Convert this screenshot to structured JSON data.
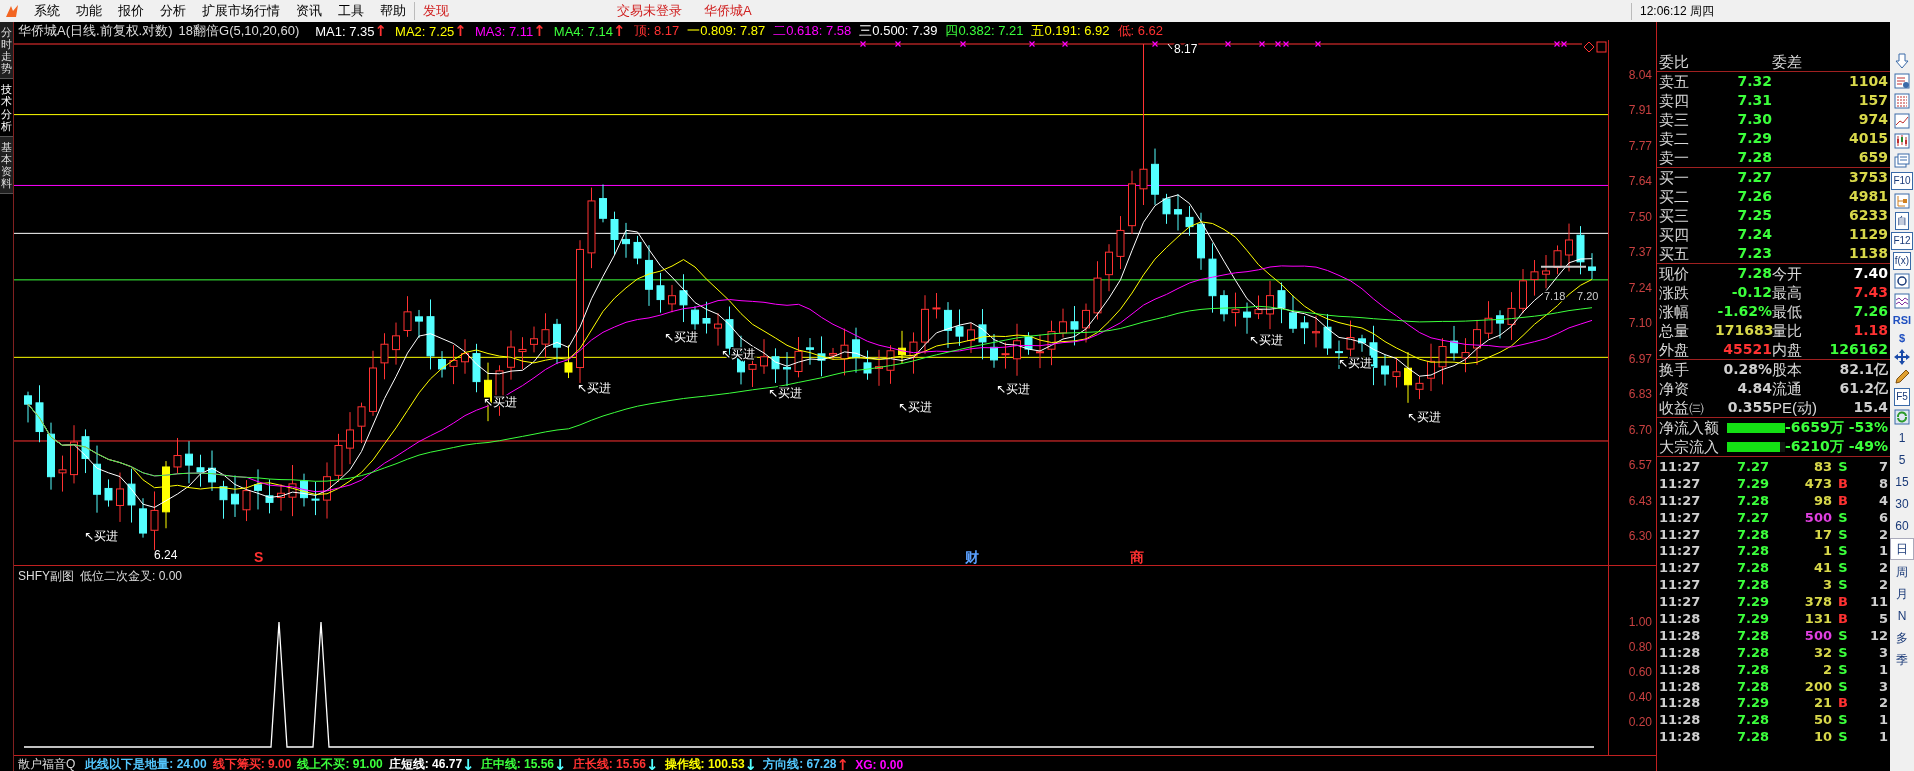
{
  "menu": {
    "items": [
      {
        "label": "系统",
        "highlighted": false
      },
      {
        "label": "功能",
        "highlighted": false
      },
      {
        "label": "报价",
        "highlighted": false
      },
      {
        "label": "分析",
        "highlighted": false
      },
      {
        "label": "扩展市场行情",
        "highlighted": false
      },
      {
        "label": "资讯",
        "highlighted": false
      },
      {
        "label": "工具",
        "highlighted": false
      },
      {
        "label": "帮助",
        "highlighted": false
      },
      {
        "label": "发现",
        "highlighted": true
      }
    ],
    "trade_status": "交易未登录",
    "stock_name": "华侨城A",
    "clock": "12:06:12 周四"
  },
  "side_tabs": [
    {
      "label": "分时走势",
      "selected": false
    },
    {
      "label": "技术分析",
      "selected": true
    },
    {
      "label": "基本资料",
      "selected": false
    }
  ],
  "chart_header": {
    "title": "华侨城A(日线.前复权.对数)",
    "indicator": "18翻倍G(5,10,20,60)",
    "values": [
      {
        "text": "MA1: 7.35",
        "color": "#ffffff",
        "arrow": {
          "text": "↑",
          "color": "#ff3232"
        }
      },
      {
        "text": "MA2: 7.25",
        "color": "#ffff00",
        "arrow": {
          "text": "↑",
          "color": "#ff3232"
        }
      },
      {
        "text": "MA3: 7.11",
        "color": "#ff00ff",
        "arrow": {
          "text": "↑",
          "color": "#ff3232"
        }
      },
      {
        "text": "MA4: 7.14",
        "color": "#3cff3c",
        "arrow": {
          "text": "↑",
          "color": "#ff3232"
        }
      },
      {
        "text": "顶: 8.17",
        "color": "#ff3232"
      },
      {
        "text": "一0.809: 7.87",
        "color": "#ffff00"
      },
      {
        "text": "二0.618: 7.58",
        "color": "#ff00ff"
      },
      {
        "text": "三0.500: 7.39",
        "color": "#ffffff"
      },
      {
        "text": "四0.382: 7.21",
        "color": "#3cff3c"
      },
      {
        "text": "五0.191: 6.92",
        "color": "#ffff00"
      },
      {
        "text": "低: 6.62",
        "color": "#ff3232"
      }
    ]
  },
  "price_axis": [
    "8.04",
    "7.91",
    "7.77",
    "7.64",
    "7.50",
    "7.37",
    "7.24",
    "7.10",
    "6.97",
    "6.83",
    "6.70",
    "6.57",
    "6.43",
    "6.30"
  ],
  "buy_signals": [
    "↖买进",
    "↖买进",
    "↖买进",
    "↖买进",
    "↖买进",
    "↖买进",
    "↖买进",
    "↖买进",
    "↖买进",
    "↖买进",
    "↖买进"
  ],
  "peak_label": "8.17",
  "low_label": "6.24",
  "range_labels": [
    "7.18",
    "7.20"
  ],
  "event_marks": [
    {
      "text": "S",
      "color": "#ff3232"
    },
    {
      "text": "财",
      "color": "#5aa0ff"
    },
    {
      "text": "商",
      "color": "#ff3232"
    }
  ],
  "sub_chart": {
    "title": "SHFY副图",
    "reading": "低位二次金叉: 0.00",
    "axis": [
      "1.00",
      "0.80",
      "0.60",
      "0.40",
      "0.20"
    ]
  },
  "bottom_bar": {
    "name": "散户福音Q",
    "values": [
      {
        "text": "此线以下是地量: 24.00",
        "color": "#54c8ff"
      },
      {
        "text": "线下筹买: 9.00",
        "color": "#ff3232"
      },
      {
        "text": "线上不买: 91.00",
        "color": "#3cff3c"
      },
      {
        "text": "庄短线: 46.77",
        "color": "#ffffff",
        "arrow": {
          "text": "↓",
          "color": "#54ffff"
        }
      },
      {
        "text": "庄中线: 15.56",
        "color": "#3cff3c",
        "arrow": {
          "text": "↓",
          "color": "#54ffff"
        }
      },
      {
        "text": "庄长线: 15.56",
        "color": "#ff3232",
        "arrow": {
          "text": "↓",
          "color": "#54ffff"
        }
      },
      {
        "text": "操作线: 100.53",
        "color": "#ffff00",
        "arrow": {
          "text": "↓",
          "color": "#54ffff"
        }
      },
      {
        "text": "方向线: 67.28",
        "color": "#54c8ff",
        "arrow": {
          "text": "↑",
          "color": "#ff3232"
        }
      },
      {
        "text": "XG: 0.00",
        "color": "#ff00ff"
      }
    ]
  },
  "quote": {
    "ratio": {
      "label": "委比",
      "label2": "委差"
    },
    "asks": [
      {
        "label": "卖五",
        "price": "7.32",
        "volume": "1104"
      },
      {
        "label": "卖四",
        "price": "7.31",
        "volume": "157"
      },
      {
        "label": "卖三",
        "price": "7.30",
        "volume": "974"
      },
      {
        "label": "卖二",
        "price": "7.29",
        "volume": "4015"
      },
      {
        "label": "卖一",
        "price": "7.28",
        "volume": "659"
      }
    ],
    "bids": [
      {
        "label": "买一",
        "price": "7.27",
        "volume": "3753"
      },
      {
        "label": "买二",
        "price": "7.26",
        "volume": "4981"
      },
      {
        "label": "买三",
        "price": "7.25",
        "volume": "6233"
      },
      {
        "label": "买四",
        "price": "7.24",
        "volume": "1129"
      },
      {
        "label": "买五",
        "price": "7.23",
        "volume": "1138"
      }
    ],
    "stats": [
      {
        "cells": [
          {
            "label": "现价",
            "value": "7.28",
            "color": "#3cff3c"
          },
          {
            "label": "今开",
            "value": "7.40",
            "color": "#ffffff"
          }
        ]
      },
      {
        "cells": [
          {
            "label": "涨跌",
            "value": "-0.12",
            "color": "#3cff3c"
          },
          {
            "label": "最高",
            "value": "7.43",
            "color": "#ff3232"
          }
        ]
      },
      {
        "cells": [
          {
            "label": "涨幅",
            "value": "-1.62%",
            "color": "#3cff3c"
          },
          {
            "label": "最低",
            "value": "7.26",
            "color": "#3cff3c"
          }
        ]
      },
      {
        "cells": [
          {
            "label": "总量",
            "value": "171683",
            "color": "#d8d84a"
          },
          {
            "label": "量比",
            "value": "1.18",
            "color": "#ff3232"
          }
        ]
      },
      {
        "cells": [
          {
            "label": "外盘",
            "value": "45521",
            "color": "#ff3232"
          },
          {
            "label": "内盘",
            "value": "126162",
            "color": "#3cff3c"
          }
        ]
      }
    ],
    "fundamentals": [
      {
        "label": "换手",
        "value": "0.28%",
        "label2": "股本",
        "value2": "82.1亿"
      },
      {
        "label": "净资",
        "value": "4.84",
        "label2": "流通",
        "value2": "61.2亿"
      },
      {
        "label": "收益㈢",
        "value": "0.355",
        "label2": "PE(动)",
        "value2": "15.4"
      }
    ],
    "flows": [
      {
        "label": "净流入额",
        "level": 1,
        "amount": "-6659万",
        "pct": "-53%"
      },
      {
        "label": "大宗流入",
        "level": 0.92,
        "amount": "-6210万",
        "pct": "-49%"
      }
    ],
    "ticks": [
      {
        "time": "11:27",
        "price": "7.27",
        "volume": "83",
        "side": "S",
        "kind": "sell",
        "big": false,
        "count": "7"
      },
      {
        "time": "11:27",
        "price": "7.29",
        "volume": "473",
        "side": "B",
        "kind": "buy",
        "big": false,
        "count": "8"
      },
      {
        "time": "11:27",
        "price": "7.28",
        "volume": "98",
        "side": "B",
        "kind": "buy",
        "big": false,
        "count": "4"
      },
      {
        "time": "11:27",
        "price": "7.27",
        "volume": "500",
        "side": "S",
        "kind": "sell",
        "big": true,
        "count": "6"
      },
      {
        "time": "11:27",
        "price": "7.28",
        "volume": "17",
        "side": "S",
        "kind": "sell",
        "big": false,
        "count": "2"
      },
      {
        "time": "11:27",
        "price": "7.28",
        "volume": "1",
        "side": "S",
        "kind": "sell",
        "big": false,
        "count": "1"
      },
      {
        "time": "11:27",
        "price": "7.28",
        "volume": "41",
        "side": "S",
        "kind": "sell",
        "big": false,
        "count": "2"
      },
      {
        "time": "11:27",
        "price": "7.28",
        "volume": "3",
        "side": "S",
        "kind": "sell",
        "big": false,
        "count": "2"
      },
      {
        "time": "11:27",
        "price": "7.29",
        "volume": "378",
        "side": "B",
        "kind": "buy",
        "big": false,
        "count": "11"
      },
      {
        "time": "11:28",
        "price": "7.29",
        "volume": "131",
        "side": "B",
        "kind": "buy",
        "big": false,
        "count": "5"
      },
      {
        "time": "11:28",
        "price": "7.28",
        "volume": "500",
        "side": "S",
        "kind": "sell",
        "big": true,
        "count": "12"
      },
      {
        "time": "11:28",
        "price": "7.28",
        "volume": "32",
        "side": "S",
        "kind": "sell",
        "big": false,
        "count": "3"
      },
      {
        "time": "11:28",
        "price": "7.28",
        "volume": "2",
        "side": "S",
        "kind": "sell",
        "big": false,
        "count": "1"
      },
      {
        "time": "11:28",
        "price": "7.28",
        "volume": "200",
        "side": "S",
        "kind": "sell",
        "big": false,
        "count": "3"
      },
      {
        "time": "11:28",
        "price": "7.29",
        "volume": "21",
        "side": "B",
        "kind": "buy",
        "big": false,
        "count": "2"
      },
      {
        "time": "11:28",
        "price": "7.28",
        "volume": "50",
        "side": "S",
        "kind": "sell",
        "big": false,
        "count": "1"
      },
      {
        "time": "11:28",
        "price": "7.28",
        "volume": "10",
        "side": "S",
        "kind": "sell",
        "big": false,
        "count": "1"
      }
    ]
  },
  "toolbar": [
    {
      "kind": "arrow-down"
    },
    {
      "kind": "report"
    },
    {
      "kind": "grid"
    },
    {
      "kind": "line"
    },
    {
      "kind": "candles"
    },
    {
      "kind": "window"
    },
    {
      "kind": "boxed",
      "text": "F10"
    },
    {
      "kind": "tree"
    },
    {
      "kind": "boxed",
      "text": "自"
    },
    {
      "kind": "boxed",
      "text": "F12"
    },
    {
      "kind": "boxed",
      "text": "f(x)"
    },
    {
      "kind": "circle"
    },
    {
      "kind": "wave"
    },
    {
      "kind": "label",
      "text": "RSI"
    },
    {
      "kind": "label",
      "text": "$"
    },
    {
      "kind": "move"
    },
    {
      "kind": "pencil"
    },
    {
      "kind": "boxed",
      "text": "F5"
    },
    {
      "kind": "refresh"
    }
  ],
  "periods": [
    {
      "label": "1",
      "selected": false
    },
    {
      "label": "5",
      "selected": false
    },
    {
      "label": "15",
      "selected": false
    },
    {
      "label": "30",
      "selected": false
    },
    {
      "label": "60",
      "selected": false
    },
    {
      "label": "日",
      "selected": true
    },
    {
      "label": "周",
      "selected": false
    },
    {
      "label": "月",
      "selected": false
    },
    {
      "label": "N",
      "selected": false
    },
    {
      "label": "多",
      "selected": false
    },
    {
      "label": "季",
      "selected": false
    }
  ]
}
